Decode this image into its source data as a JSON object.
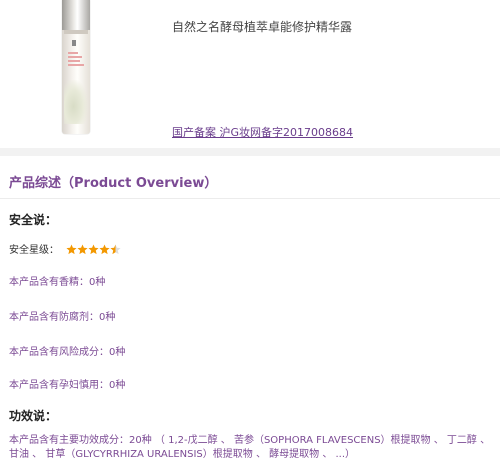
{
  "product": {
    "name": "自然之名酵母植萃卓能修护精华露",
    "registration_link": "国产备案 沪G妆网备字2017008684",
    "image_icon": "product-bottle-image"
  },
  "overview": {
    "title": "产品综述（Product Overview）",
    "safety_heading": "安全说：",
    "safety_rating_label": "安全星级：",
    "safety_rating_stars": 4.5,
    "safety_rating_max": 5,
    "star_color": "#f39800",
    "info_lines": [
      "本产品含有香精：0种",
      "本产品含有防腐剂：0种",
      "本产品含有风险成分：0种",
      "本产品含有孕妇慎用：0种"
    ],
    "effect_heading": "功效说：",
    "effect_text": "本产品含有主要功效成分：20种 （ 1,2-戊二醇 、 苦参（SOPHORA FLAVESCENS）根提取物 、 丁二醇 、 甘油 、 甘草（GLYCYRRHIZA URALENSIS）根提取物 、 酵母提取物 、 ...）"
  },
  "colors": {
    "accent": "#7b4a94",
    "background": "#f2f2f2"
  }
}
